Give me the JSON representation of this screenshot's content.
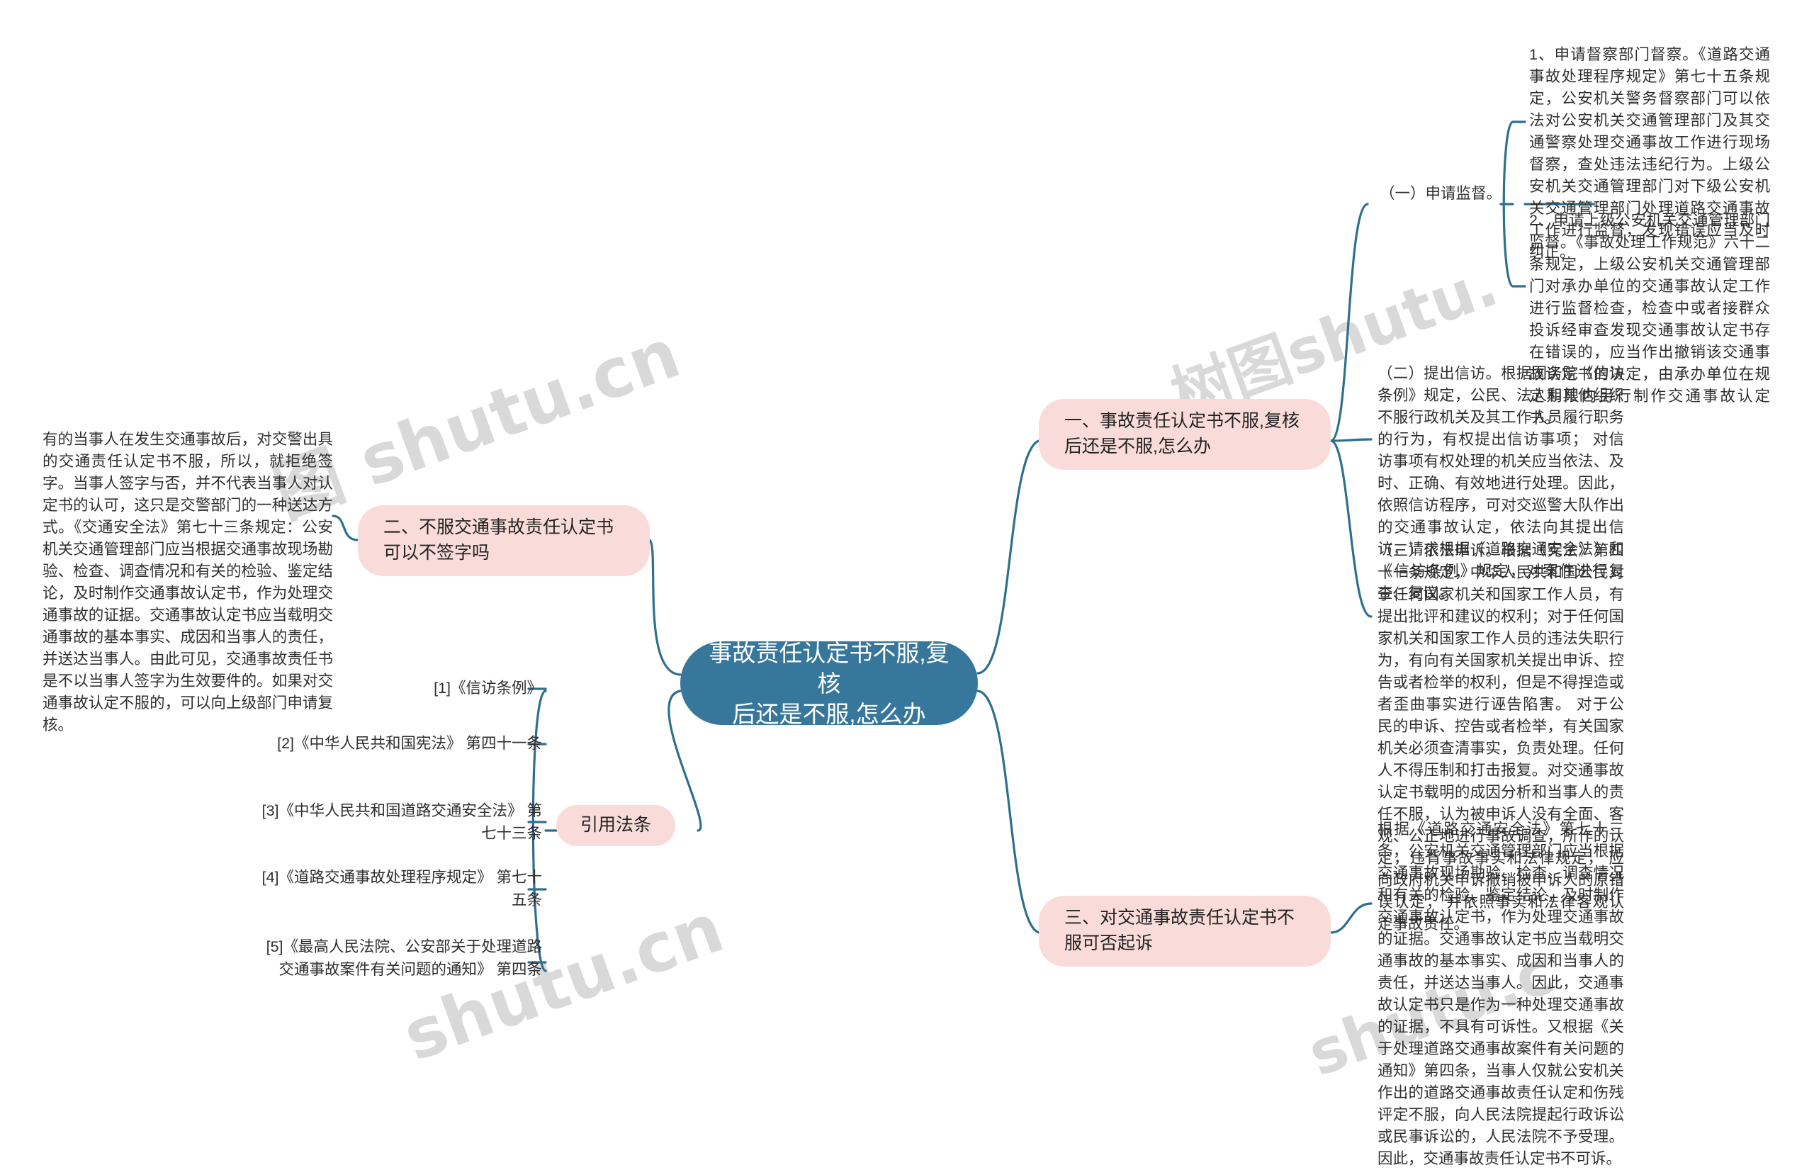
{
  "mindmap": {
    "root": {
      "label": "事故责任认定书不服,复核\n后还是不服,怎么办"
    },
    "watermarks": {
      "a": "图 shutu.cn",
      "b": "树图shutu.",
      "c": "shutu.cn",
      "d": "shutu.c"
    },
    "branches": {
      "topic_1": {
        "label": "一、事故责任认定书不服,复核后还是不服,怎么办",
        "children": {
          "supervision_label": "（一）申请监督。",
          "supervision_items": [
            "1、申请督察部门督察。《道路交通事故处理程序规定》第七十五条规定，公安机关警务督察部门可以依法对公安机关交通管理部门及其交通警察处理交通事故工作进行现场督察，查处违法违纪行为。上级公安机关交通管理部门对下级公安机关交通管理部门处理道路交通事故工作进行监督，发现错误应当及时纠正。",
            "2、申请上级公安机关交通管理部门监督。《事故处理工作规范》六十二条规定，上级公安机关交通管理部门对承办单位的交通事故认定工作进行监督检查，检查中或者接群众投诉经审查发现交通事故认定书存在错误的，应当作出撤销该交通事故认定书的决定，由承办单位在规定期限内另行制作交通事故认定书。"
          ],
          "petition": "（二）提出信访。根据国务院《信访条例》规定，公民、法人和其他组织不服行政机关及其工作人员履行职务的行为，有权提出信访事项；  对信访事项有权处理的机关应当依法、及时、正确、有效地进行处理。因此，依照信访程序，可对交巡警大队作出的交通事故认定，依法向其提出信访，请求根据《道路交通安全法》和《信访条例》规定，对案件进行复查、复议。",
          "appeal": "（三）依法申诉。根据《宪法》第四十一条规定，中华人民共和国公民对于任何国家机关和国家工作人员，有提出批评和建议的权利；对于任何国家机关和国家工作人员的违法失职行为，有向有关国家机关提出申诉、控告或者检举的权利，但是不得捏造或者歪曲事实进行诬告陷害。 对于公民的申诉、控告或者检举，有关国家机关必须查清事实，负责处理。任何人不得压制和打击报复。对交通事故认定书载明的成因分析和当事人的责任不服，认为被申诉人没有全面、客观、公正地进行事故调查，所作的认定，违背事故事实和法律规定， 应向政府机关申诉撤销被申诉人的原错误认定； 并依照事实和法律客观认定事故责任。"
        }
      },
      "topic_2": {
        "label": "二、不服交通事故责任认定书可以不签字吗",
        "children": {
          "intro": "有的当事人在发生交通事故后，对交警出具的交通责任认定书不服，所以，就拒绝签字。当事人签字与否，并不代表当事人对认定书的认可，这只是交警部门的一种送达方式。《交通安全法》第七十三条规定：公安机关交通管理部门应当根据交通事故现场勘验、检查、调查情况和有关的检验、鉴定结论，及时制作交通事故认定书，作为处理交通事故的证据。交通事故认定书应当载明交通事故的基本事实、成因和当事人的责任，并送达当事人。由此可见，交通事故责任书是不以当事人签字为生效要件的。如果对交通事故认定不服的，可以向上级部门申请复核。"
        }
      },
      "topic_3": {
        "label": "三、对交通事故责任认定书不服可否起诉",
        "children": {
          "body": "根据《道路交通安全法》第七十三条，公安机关交通管理部门应当根据交通事故现场勘验、检查、调查情况和有关的检验、鉴定结论，及时制作交通事故认定书，作为处理交通事故的证据。交通事故认定书应当载明交通事故的基本事实、成因和当事人的责任，并送达当事人。因此，交通事故认定书只是作为一种处理交通事故的证据，不具有可诉性。又根据《关于处理道路交通事故案件有关问题的通知》第四条，当事人仅就公安机关作出的道路交通事故责任认定和伤残评定不服，向人民法院提起行政诉讼或民事诉讼的，人民法院不予受理。因此，交通事故责任认定书不可诉。"
        }
      },
      "references": {
        "label": "引用法条",
        "items": [
          "[1]《信访条例》",
          "[2]《中华人民共和国宪法》 第四十一条",
          "[3]《中华人民共和国道路交通安全法》 第七十三条",
          "[4]《道路交通事故处理程序规定》 第七十五条",
          "[5]《最高人民法院、公安部关于处理道路交通事故案件有关问题的通知》 第四条"
        ]
      }
    },
    "colors": {
      "root_fill": "#36779b",
      "topic_fill": "#f9dcd9",
      "connector": "#2e6f8e",
      "text": "#2f2f2f",
      "watermark": "#d9d9d9"
    }
  }
}
